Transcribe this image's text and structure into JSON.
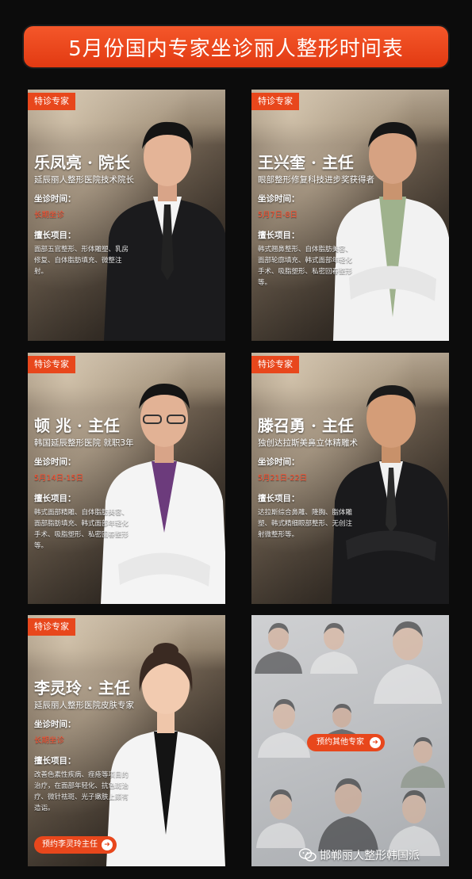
{
  "header": {
    "title": "5月份国内专家坐诊丽人整形时间表"
  },
  "tag_label": "特诊专家",
  "time_label": "坐诊时间：",
  "specialty_label": "擅长项目：",
  "experts": [
    {
      "name": "乐凤亮 · 院长",
      "subtitle": "延辰丽人整形医院技术院长",
      "time": "长期坐诊",
      "specialties": "面部五官整形、形体雕塑、乳房修复、自体脂肪填充、微整注射。"
    },
    {
      "name": "王兴奎 · 主任",
      "subtitle": "眼部整形修复科技进步奖获得者",
      "time": "5月7日-8日",
      "specialties": "韩式翘鼻整形、自体脂肪美容、面部轮廓填充、韩式面部年轻化手术、吸脂塑形、私密回春整形等。"
    },
    {
      "name": "顿 兆 · 主任",
      "subtitle": "韩国延辰整形医院 就职3年",
      "time": "5月14日-15日",
      "specialties": "韩式面部精雕、自体脂肪美容、面部脂肪填充、韩式面部年轻化手术、吸脂塑形、私密回春整形等。"
    },
    {
      "name": "滕召勇 · 主任",
      "subtitle": "独创达拉斯美鼻立体精雕术",
      "time": "5月21日-22日",
      "specialties": "达拉斯综合鼻雕、隆胸、脂体雕塑、韩式精细眼部整形、无创注射微整形等。"
    },
    {
      "name": "李灵玲 · 主任",
      "subtitle": "延辰丽人整形医院皮肤专家",
      "time": "长期坐诊",
      "specialties": "改善色素性疾病、痤疮等项目的治疗，在面部年轻化、抗色斑治疗、微针祛斑、光子嫩肤上颇有造诣。",
      "book_button": "预约李灵玲主任"
    }
  ],
  "others": {
    "book_button": "预约其他专家"
  },
  "watermark": {
    "text": "邯郸丽人整形韩国派",
    "icon": "wechat-icon"
  },
  "colors": {
    "accent": "#e8471c",
    "time_text": "#ff5030",
    "background": "#0c0c0c"
  }
}
